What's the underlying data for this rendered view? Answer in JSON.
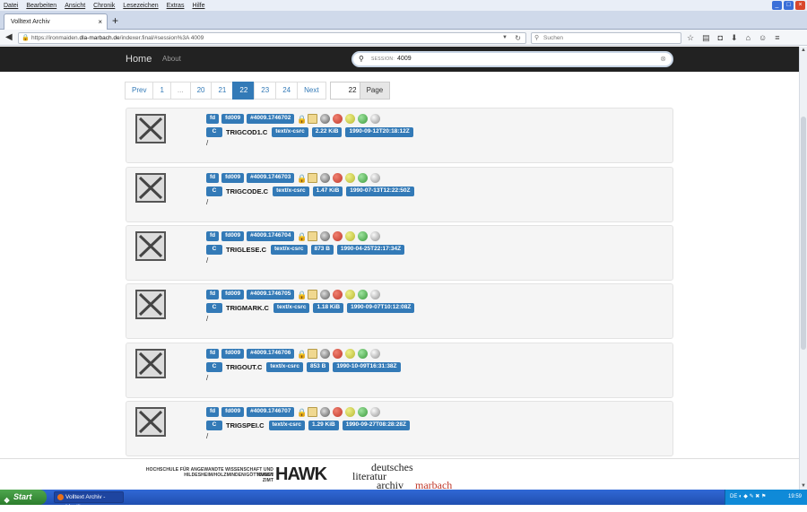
{
  "browser": {
    "menu": [
      "Datei",
      "Bearbeiten",
      "Ansicht",
      "Chronik",
      "Lesezeichen",
      "Extras",
      "Hilfe"
    ],
    "tab_title": "Volltext Archiv",
    "url_prefix": "https://ironmaiden.",
    "url_host": "dla-marbach.de",
    "url_path": "/indexer.final/#session%3A 4009",
    "search_placeholder": "Suchen"
  },
  "app": {
    "brand": "Home",
    "about": "About",
    "session_label": "SESSION:",
    "session_value": "4009"
  },
  "pagination": {
    "prev": "Prev",
    "pages": [
      "1",
      "...",
      "20",
      "21",
      "22",
      "23",
      "24"
    ],
    "active": "22",
    "next": "Next",
    "page_input": "22",
    "page_button": "Page"
  },
  "records": [
    {
      "disk": "fd",
      "id": "fd009",
      "hash": "#4009.1746702",
      "lang": "C",
      "name": "TRIGCOD1.C",
      "mime": "text/x-csrc",
      "size": "2.22 KiB",
      "date": "1990-09-12T20:18:12Z",
      "path": "/"
    },
    {
      "disk": "fd",
      "id": "fd009",
      "hash": "#4009.1746703",
      "lang": "C",
      "name": "TRIGCODE.C",
      "mime": "text/x-csrc",
      "size": "1.47 KiB",
      "date": "1990-07-13T12:22:50Z",
      "path": "/"
    },
    {
      "disk": "fd",
      "id": "fd009",
      "hash": "#4009.1746704",
      "lang": "C",
      "name": "TRIGLESE.C",
      "mime": "text/x-csrc",
      "size": "873 B",
      "date": "1990-04-25T22:17:34Z",
      "path": "/"
    },
    {
      "disk": "fd",
      "id": "fd009",
      "hash": "#4009.1746705",
      "lang": "C",
      "name": "TRIGMARK.C",
      "mime": "text/x-csrc",
      "size": "1.18 KiB",
      "date": "1990-09-07T10:12:08Z",
      "path": "/"
    },
    {
      "disk": "fd",
      "id": "fd009",
      "hash": "#4009.1746706",
      "lang": "C",
      "name": "TRIGOUT.C",
      "mime": "text/x-csrc",
      "size": "853 B",
      "date": "1990-10-09T16:31:38Z",
      "path": "/"
    },
    {
      "disk": "fd",
      "id": "fd009",
      "hash": "#4009.1746707",
      "lang": "C",
      "name": "TRIGSPEI.C",
      "mime": "text/x-csrc",
      "size": "1.29 KiB",
      "date": "1990-09-27T08:28:28Z",
      "path": "/"
    }
  ],
  "footer": {
    "hs_line1": "HOCHSCHULE FÜR ANGEWANDTE WISSENSCHAFT UND KUNST",
    "hs_line2": "HILDESHEIM/HOLZMINDEN/GÖTTINGEN",
    "hs_line3": "ZIMT",
    "hawk": "HAWK",
    "dla_1": "deutsches",
    "dla_2": "literatur",
    "dla_3": "archiv",
    "dla_4": "marbach"
  },
  "taskbar": {
    "start": "Start",
    "task": "Volltext Archiv - Mozill...",
    "lang": "DE",
    "clock": "19:59"
  },
  "colors": {
    "label_blue": "#337ab7",
    "navbar": "#222222",
    "taskbar": "#245edb"
  }
}
